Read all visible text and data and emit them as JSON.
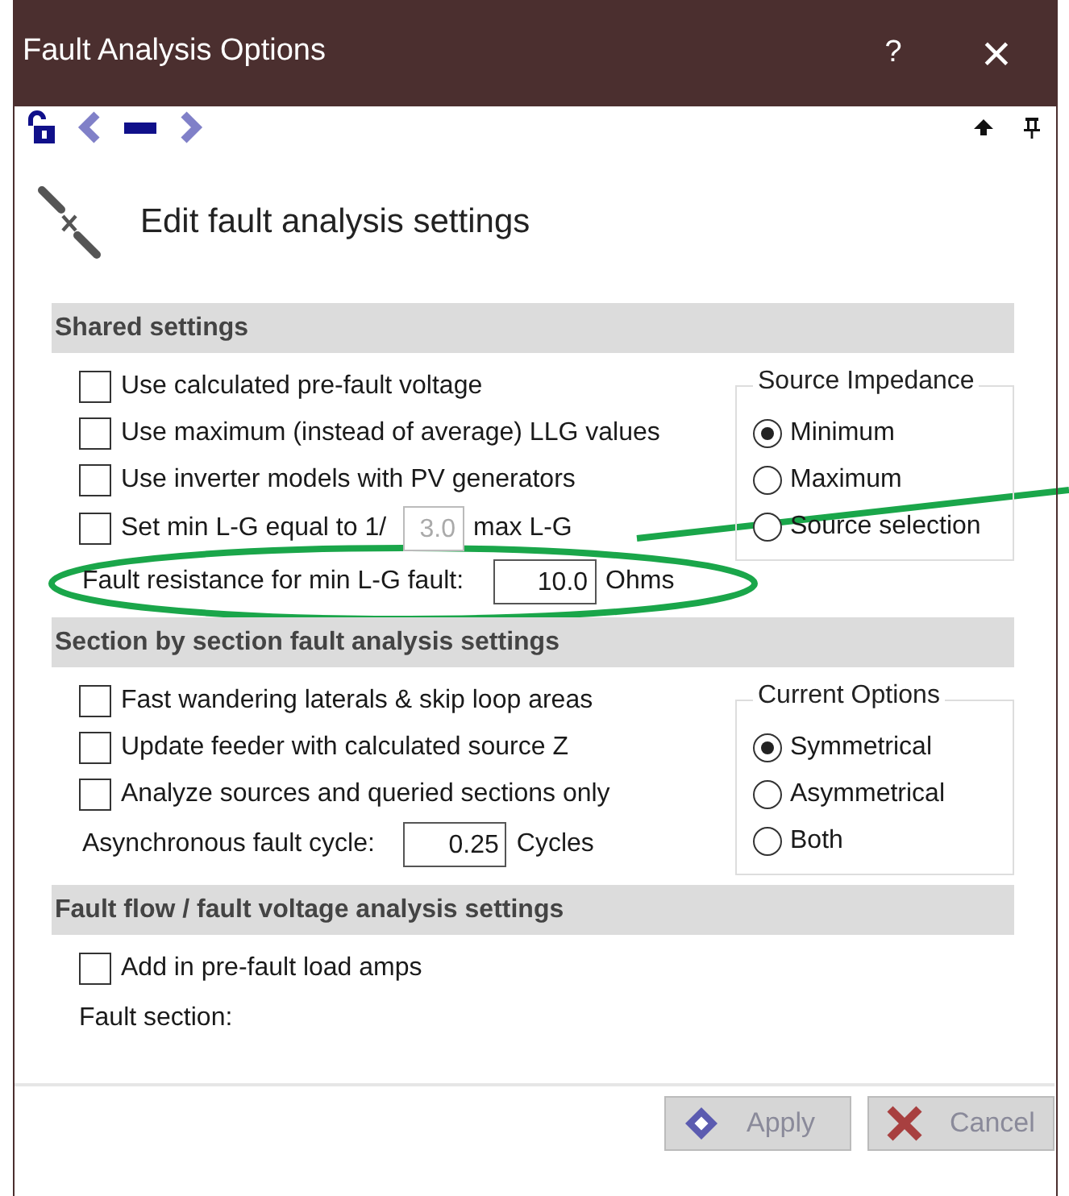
{
  "window": {
    "title": "Fault Analysis Options",
    "help": "?",
    "close": "×"
  },
  "heading": "Edit fault analysis settings",
  "sections": [
    {
      "title": "Shared settings",
      "rows": [
        {
          "kind": "checkbox",
          "label": "Use calculated pre-fault voltage",
          "checked": false
        },
        {
          "kind": "checkbox",
          "label": "Use maximum (instead of average) LLG values",
          "checked": false
        },
        {
          "kind": "checkbox",
          "label": "Use inverter models with PV generators",
          "checked": false
        },
        {
          "kind": "checkbox_field",
          "label": "Set min L-G equal to 1/",
          "value": "3.0",
          "disabled": true,
          "suffix": "max L-G",
          "checked": false
        },
        {
          "kind": "field",
          "label": "Fault resistance for min L-G fault:",
          "value": "10.0",
          "suffix": "Ohms"
        }
      ],
      "group": {
        "title": "Source Impedance",
        "options": [
          {
            "label": "Minimum",
            "selected": true
          },
          {
            "label": "Maximum",
            "selected": false
          },
          {
            "label": "Source selection",
            "selected": false
          }
        ]
      }
    },
    {
      "title": "Section by section fault analysis settings",
      "rows": [
        {
          "kind": "checkbox",
          "label": "Fast wandering laterals & skip loop areas",
          "checked": false
        },
        {
          "kind": "checkbox",
          "label": "Update feeder with calculated source Z",
          "checked": false
        },
        {
          "kind": "checkbox",
          "label": "Analyze sources and queried sections only",
          "checked": false
        },
        {
          "kind": "field",
          "label": "Asynchronous fault cycle:",
          "value": "0.25",
          "suffix": "Cycles"
        }
      ],
      "group": {
        "title": "Current Options",
        "options": [
          {
            "label": "Symmetrical",
            "selected": true
          },
          {
            "label": "Asymmetrical",
            "selected": false
          },
          {
            "label": "Both",
            "selected": false
          }
        ]
      }
    },
    {
      "title": "Fault flow / fault voltage analysis settings",
      "rows": [
        {
          "kind": "checkbox",
          "label": "Add in pre-fault load amps",
          "checked": false
        },
        {
          "kind": "text",
          "label": "Fault section:"
        }
      ]
    }
  ],
  "buttons": [
    {
      "kind": "apply",
      "label": "Apply",
      "disabled": true
    },
    {
      "kind": "cancel",
      "label": "Cancel",
      "disabled": true
    }
  ]
}
